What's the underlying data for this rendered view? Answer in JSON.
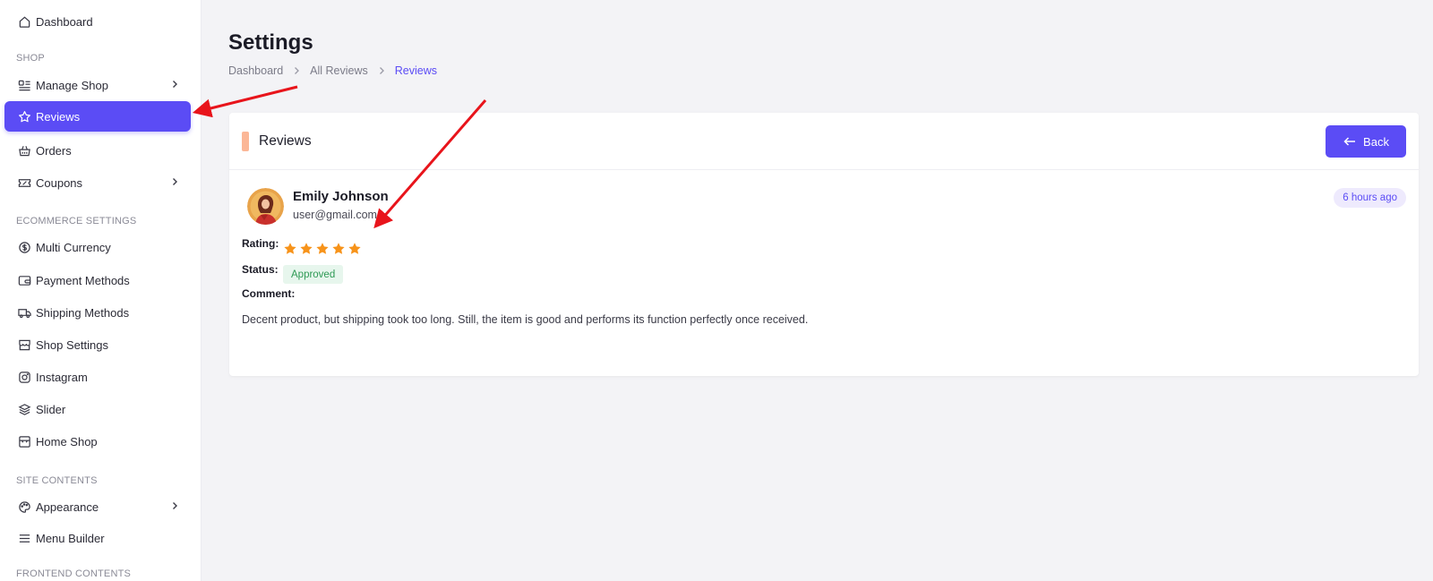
{
  "sidebar": {
    "items": [
      {
        "label": "Dashboard",
        "icon": "home-icon"
      },
      {
        "label": "Manage Shop",
        "icon": "manage-shop-icon"
      },
      {
        "label": "Reviews",
        "icon": "star-icon"
      },
      {
        "label": "Orders",
        "icon": "basket-icon"
      },
      {
        "label": "Coupons",
        "icon": "coupon-icon"
      },
      {
        "label": "Multi Currency",
        "icon": "currency-icon"
      },
      {
        "label": "Payment Methods",
        "icon": "wallet-icon"
      },
      {
        "label": "Shipping Methods",
        "icon": "truck-icon"
      },
      {
        "label": "Shop Settings",
        "icon": "store-icon"
      },
      {
        "label": "Instagram",
        "icon": "instagram-icon"
      },
      {
        "label": "Slider",
        "icon": "layers-icon"
      },
      {
        "label": "Home Shop",
        "icon": "store-icon"
      },
      {
        "label": "Appearance",
        "icon": "palette-icon"
      },
      {
        "label": "Menu Builder",
        "icon": "menu-icon"
      }
    ],
    "sections": {
      "shop": "SHOP",
      "ecommerce": "ECOMMERCE SETTINGS",
      "site_contents": "SITE CONTENTS",
      "frontend_contents": "FRONTEND CONTENTS"
    },
    "active_item": "Reviews"
  },
  "header": {
    "title": "Settings",
    "breadcrumb": [
      "Dashboard",
      "All Reviews",
      "Reviews"
    ]
  },
  "card": {
    "title": "Reviews",
    "back_label": "Back",
    "review": {
      "name": "Emily Johnson",
      "email": "user@gmail.com",
      "time": "6 hours ago",
      "rating_label": "Rating:",
      "rating": 5,
      "rating_max": 5,
      "status_label": "Status:",
      "status": "Approved",
      "comment_label": "Comment:",
      "comment": "Decent product, but shipping took too long. Still, the item is good and performs its function perfectly once received."
    }
  },
  "colors": {
    "accent": "#5b4cf5",
    "star": "#f7931a",
    "status_green": "#2f9a55",
    "annotation_arrow": "#e8141b"
  }
}
